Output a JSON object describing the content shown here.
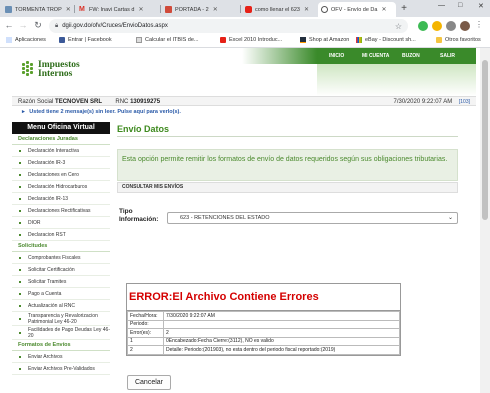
{
  "browser": {
    "tabs": [
      {
        "label": "TORMENTA TROP",
        "active": false,
        "icon": "storm-icon"
      },
      {
        "label": "FW: Inavi Cartas d",
        "active": false,
        "icon": "gmail-icon"
      },
      {
        "label": "PORTADA - 2",
        "active": false,
        "icon": "portada-icon"
      },
      {
        "label": "como llenar el 623",
        "active": false,
        "icon": "youtube-icon"
      },
      {
        "label": "OFV - Envío de Da",
        "active": true,
        "icon": "dgii-icon"
      }
    ],
    "new_tab_symbol": "+",
    "window_controls": {
      "minimize": "—",
      "maximize": "□",
      "close": "✕"
    },
    "url": "dgii.gov.do/ofv/Cruces/EnvioDatos.aspx",
    "bookmarks": [
      {
        "label": "Aplicaciones",
        "icon": "apps-grid-icon"
      },
      {
        "label": "Entrar | Facebook",
        "icon": "facebook-icon"
      },
      {
        "label": "Calcular el ITBIS de...",
        "icon": "page-icon"
      },
      {
        "label": "Excel 2010 Introduc...",
        "icon": "youtube-icon"
      },
      {
        "label": "Shop at Amazon",
        "icon": "amazon-icon"
      },
      {
        "label": "eBay - Discount sh...",
        "icon": "ebay-icon"
      }
    ],
    "other_bookmarks": "Otros favoritos"
  },
  "site": {
    "logo_line1": "Impuestos",
    "logo_line2": "Internos",
    "top_nav": [
      "INICIO",
      "MI CUENTA",
      "BUZON",
      "SALIR"
    ]
  },
  "infobar": {
    "razon_label": "Razón Social",
    "razon_value": "TECNOVEN SRL",
    "rnc_label": "RNC",
    "rnc_value": "130919275",
    "datetime": "7/30/2020 9:22:07 AM",
    "index": "[103]"
  },
  "message": "Usted tiene 2 mensaje(s) sin leer. Pulse aquí para verlo(s).",
  "sidebar": {
    "title": "Menu Oficina Virtual",
    "sections": [
      {
        "heading": "Declaraciones Juradas",
        "items": [
          "Declaración Interactiva",
          "Declaración IR-3",
          "Declaraciones en Cero",
          "Declaración Hidrocarburos",
          "Declaración IR-13",
          "Declaraciones Rectificativas",
          "DIOR",
          "Declaracion RST"
        ]
      },
      {
        "heading": "Solicitudes",
        "items": [
          "Comprobantes Fiscales",
          "Solicitar Certificación",
          "Solicitar Tramites",
          "Pago a Cuenta",
          "Actualización al RNC",
          "Transparencia y Revalorizacion Patrimonial Ley 46-20",
          "Facilidades de Pago Deudas Ley 46-20"
        ]
      },
      {
        "heading": "Formatos de Envíos",
        "items": [
          "Enviar Archivos",
          "Enviar Archivos Pre-Validados"
        ]
      }
    ]
  },
  "main": {
    "title": "Envío Datos",
    "description": "Esta opción permite remitir los formatos de envío de datos requeridos según sus obligaciones tributarias.",
    "consultar": "CONSULTAR MIS ENVÍOS",
    "tipo_label_line1": "Tipo",
    "tipo_label_line2": "Información:",
    "tipo_selected": "623 - RETENCIONES DEL ESTADO",
    "error": {
      "title": "ERROR:El Archivo Contiene Errores",
      "fecha_label": "Fecha/Hora:",
      "fecha_value": "7/30/2020 9:22:07 AM",
      "periodo_label": "Periodo:",
      "periodo_value": "",
      "errores_label": "Error(es):",
      "errores_value": "2",
      "rows": [
        {
          "num": "1",
          "detail": "0Encabezado:Fecha Cierre:(3112), NO es valido"
        },
        {
          "num": "2",
          "detail": "Detalle: Periodo:(201903), no esta dentro del periodo fiscal reportado:(2019)"
        }
      ]
    },
    "cancel_label": "Cancelar"
  }
}
